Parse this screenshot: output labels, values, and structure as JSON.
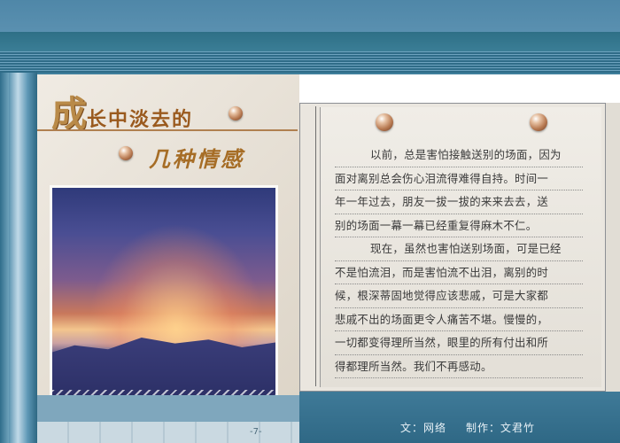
{
  "title": {
    "first_char": "成",
    "line1_rest": "长中淡去的",
    "line2": "几种情感"
  },
  "poem": {
    "lines": [
      "以前，总是害怕接触送别的场面，因为",
      "面对离别总会伤心泪流得难得自持。时间一",
      "年一年过去，朋友一拔一拔的来来去去，送",
      "别的场面一幕一幕已经重复得麻木不仁。",
      "现在，虽然也害怕送别场面，可是已经",
      "不是怕流泪，而是害怕流不出泪，离别的时",
      "候，根深蒂固地觉得应该悲戚，可是大家都",
      "悲戚不出的场面更令人痛苦不堪。慢慢的，",
      "一切都变得理所当然，眼里的所有付出和所",
      "得都理所当然。我们不再感动。"
    ]
  },
  "footer": {
    "page": "-7-",
    "author": "文：网络",
    "producer": "制作：文君竹"
  },
  "icons": {
    "orb": "pearl-orb-icon"
  },
  "colors": {
    "title": "#a06a2a",
    "frame": "#3f7f9c"
  }
}
